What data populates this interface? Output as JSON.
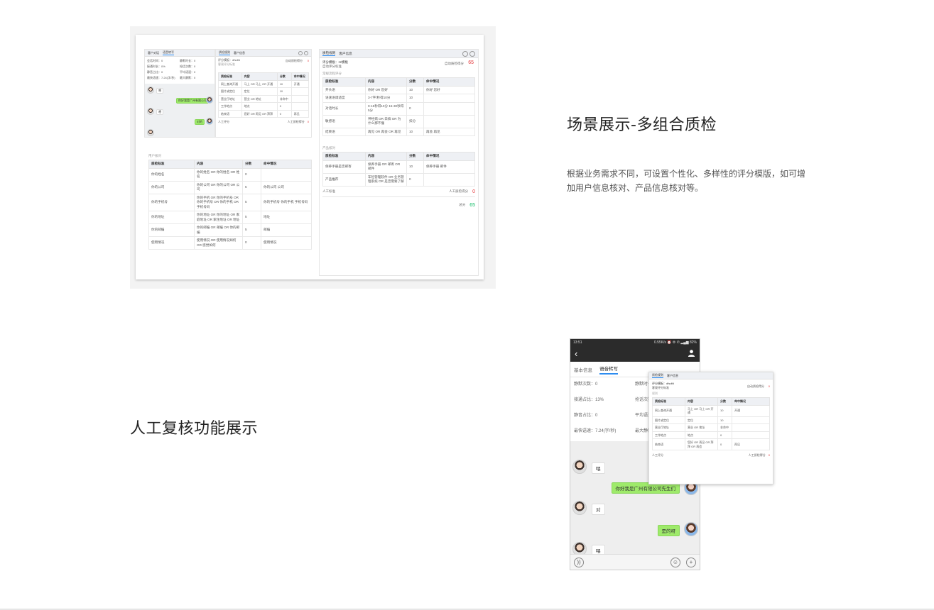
{
  "section1": {
    "title": "场景展示-多组合质检",
    "description": "根据业务需求不同，可设置个性化、多样性的评分模版，如可增加用户信息核对、产品信息核对等。"
  },
  "section2": {
    "title": "人工复核功能展示"
  },
  "screenshot1": {
    "chat_panel": {
      "tabs": [
        "客户对话",
        "语音转写"
      ],
      "info": [
        "会话时间：0",
        "静默时长：0",
        "接通时长：0%",
        "抢话次数：0",
        "静音占比：0",
        "平均语速：0",
        "最快语速：7.24(字/秒)",
        "最大静默：0"
      ],
      "msgs": [
        "喂",
        "你好我是广州有限公司",
        "喂",
        "对的"
      ]
    },
    "score_panel_small": {
      "template": "评分模板：dfsdfd",
      "tag": "客观评分标准",
      "auto_label": "自动质检得分",
      "auto_value": "0",
      "manual_label": "人工评分",
      "manual_value": "人工质检得分",
      "manual_score": "0",
      "columns": [
        "质检标准",
        "内容",
        "分数",
        "命中情况"
      ],
      "rows": [
        [
          "网上查询开通",
          "马上 OR 马上 OR 开通",
          "10",
          "开通"
        ],
        [
          "图片或定位",
          "定位",
          "10",
          ""
        ],
        [
          "营业厅地址",
          "营业 OR 地址",
          "非命中",
          ""
        ],
        [
          "工作地点",
          "地点",
          "0",
          ""
        ],
        [
          "结束语",
          "您好 OR 再见 OR 拜拜",
          "0",
          "再见"
        ]
      ]
    },
    "user_info": {
      "section_label": "用户核对",
      "columns": [
        "质检标准",
        "内容",
        "分数",
        "命中情况"
      ],
      "rows": [
        [
          "你的姓名",
          "你的姓名 OR 你的姓名 OR 姓名",
          "0",
          ""
        ],
        [
          "你的公司",
          "你的公司 OR 你的公司 OR 公司",
          "5",
          "你的公司 公司"
        ],
        [
          "你的手机号",
          "你的手机 OR 你的手机号 OR 你的手机号 OR 你的手机 OR 手机号码",
          "5",
          "你的手机号 你的手机 手机号码"
        ],
        [
          "你的地址",
          "你的地址 OR 你的地址 OR 家庭地址 OR 家住地址 OR 地址",
          "5",
          "地址"
        ],
        [
          "你的邮编",
          "你的邮编 OR 邮编 OR 你的邮编",
          "5",
          "邮编"
        ],
        [
          "使用情况",
          "使用情况 OR 使用情况如何 OR 感觉如何",
          "0",
          "使用情况"
        ]
      ]
    },
    "quality_panel": {
      "tabs": [
        "质检规则",
        "客户信息"
      ],
      "template": "评分模板：zz模板",
      "subtitle": "自动评分标准",
      "auto_label": "自动质检得分",
      "auto_value": "65",
      "section_a": "常规流程评分",
      "columns": [
        "质检标准",
        "内容",
        "分数",
        "命中情况"
      ],
      "rows_a": [
        [
          "开头语",
          "你好 OR 您好",
          "10",
          "你好 您好"
        ],
        [
          "语速语调适度",
          "3-7字/秒得10分",
          "10",
          ""
        ],
        [
          "对话时长",
          "0-15秒得10分 15-30秒得5分",
          "0",
          ""
        ],
        [
          "敏感语",
          "神经病 OR 白痴 OR 为什么那不懂",
          "扣分",
          ""
        ],
        [
          "结束语",
          "再见 OR 再会 OR 再见",
          "10",
          "再会 再见"
        ]
      ],
      "section_b": "产品核对",
      "rows_b": [
        [
          "保养手册是否邮寄",
          "保养手册 OR 邮寄 OR 邮件",
          "10",
          "保养手册 邮件"
        ],
        [
          "产品推荐",
          "车险管理软件 OR 业务管理系统 OR 是否需要了解",
          "0",
          ""
        ]
      ],
      "manual_label": "人工标准",
      "manual_score_label": "人工质检得分",
      "manual_score": "0",
      "total_label": "总分",
      "total_value": "65"
    }
  },
  "phone": {
    "status_left": "13:51",
    "status_right": "0.55K/s ⏰ ⚙ ✆ ▂▄▆ 82%",
    "back_icon": "‹",
    "user_icon": "person-icon",
    "tabs": [
      "基本信息",
      "语音转写"
    ],
    "stats": [
      "静默次数：0",
      "静默时长：0",
      "接通占比：13%",
      "抢话次数：0",
      "静音占比：0",
      "平均语速：5",
      "最快语速：7.24(字/秒)",
      "最大静默：0"
    ],
    "messages": [
      {
        "side": "left",
        "text": "喂"
      },
      {
        "side": "right",
        "text": "你好我是广州有限公司先生们"
      },
      {
        "side": "left",
        "text": "对"
      },
      {
        "side": "right",
        "text": "是的呀"
      },
      {
        "side": "left",
        "text": "喂"
      }
    ]
  },
  "overlay": {
    "tabs": [
      "质检规则",
      "客户信息"
    ],
    "template": "评分模板：dfsdfd",
    "tag": "客观评分标准",
    "auto_label": "自动质检得分",
    "auto_value": "0",
    "section": "规则",
    "columns": [
      "质检标准",
      "内容",
      "分数",
      "命中情况"
    ],
    "rows": [
      [
        "网上查询开通",
        "马上 OR 马上 OR 开通",
        "10",
        "开通"
      ],
      [
        "图片或定位",
        "定位",
        "10",
        ""
      ],
      [
        "营业厅地址",
        "营业 OR 地址",
        "非命中",
        ""
      ],
      [
        "工作地点",
        "地点",
        "0",
        ""
      ],
      [
        "结束语",
        "您好 OR 再见 OR 拜拜 OR 再会",
        "0",
        "再见"
      ]
    ],
    "manual_label": "人工评分",
    "manual_score_label": "人工质检得分",
    "manual_score": "0"
  }
}
